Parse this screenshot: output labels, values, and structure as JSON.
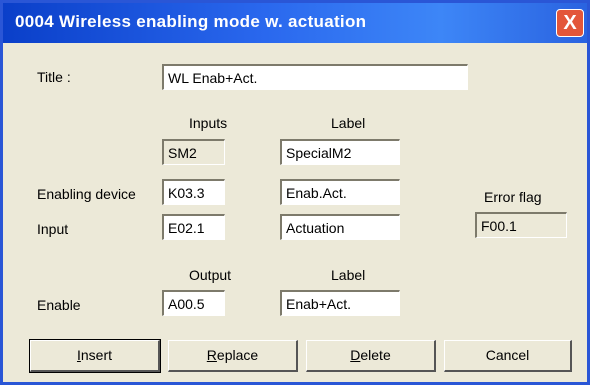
{
  "window": {
    "title": "0004  Wireless enabling mode w. actuation",
    "close_symbol": "X"
  },
  "title_row": {
    "label": "Title :",
    "value": "WL Enab+Act."
  },
  "headers": {
    "inputs": "Inputs",
    "label1": "Label",
    "output": "Output",
    "label2": "Label",
    "error_flag": "Error flag"
  },
  "rows": {
    "sm": {
      "input": "SM2",
      "label": "SpecialM2"
    },
    "enabling_device": {
      "name": "Enabling device",
      "input": "K03.3",
      "label": "Enab.Act."
    },
    "input": {
      "name": "Input",
      "input": "E02.1",
      "label": "Actuation"
    },
    "enable": {
      "name": "Enable",
      "output": "A00.5",
      "label": "Enab+Act."
    }
  },
  "error_flag_value": "F00.1",
  "buttons": {
    "insert": {
      "m": "I",
      "rest": "nsert"
    },
    "replace": {
      "m": "R",
      "rest": "eplace"
    },
    "delete": {
      "m": "D",
      "rest": "elete"
    },
    "cancel": "Cancel"
  }
}
